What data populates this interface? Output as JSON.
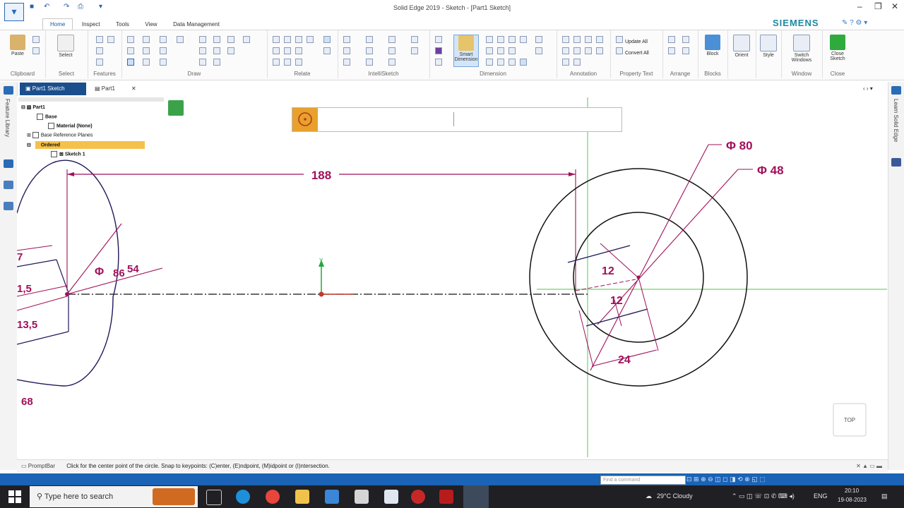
{
  "window": {
    "title": "Solid Edge 2019 - Sketch - [Part1 Sketch]",
    "brand": "SIEMENS",
    "controls": [
      "–",
      "❐",
      "✕"
    ]
  },
  "ribbon": {
    "tabs": [
      "Home",
      "Inspect",
      "Tools",
      "View",
      "Data Management"
    ],
    "active_tab": "Home",
    "groups": {
      "clipboard": {
        "label": "Clipboard",
        "paste": "Paste"
      },
      "select": {
        "label": "Select",
        "select": "Select"
      },
      "features": {
        "label": "Features"
      },
      "draw": {
        "label": "Draw"
      },
      "relate": {
        "label": "Relate"
      },
      "intellisketch": {
        "label": "IntelliSketch"
      },
      "dimension": {
        "label": "Dimension",
        "smart": "Smart Dimension"
      },
      "annotation": {
        "label": "Annotation"
      },
      "property_text": {
        "label": "Property Text",
        "update_all": "Update All",
        "convert_all": "Convert All"
      },
      "arrange": {
        "label": "Arrange"
      },
      "blocks": {
        "label": "Blocks",
        "block": "Block"
      },
      "window": {
        "label": "Window",
        "switch": "Switch Windows"
      },
      "close": {
        "label": "Close",
        "close_sketch": "Close Sketch"
      },
      "orient": {
        "label": "Orient"
      },
      "style": {
        "label": "Style"
      }
    }
  },
  "doc_tabs": {
    "tab1": "Part1 Sketch",
    "tab2": "Part1",
    "close": "✕",
    "nav": "‹ › ▾"
  },
  "left_dock": {
    "library": "Feature Library"
  },
  "right_dock": {
    "learn": "Learn Solid Edge"
  },
  "pathfinder": {
    "root": "Part1",
    "base": "Base",
    "material": "Material (None)",
    "planes": "Base Reference Planes",
    "ordered": "Ordered",
    "sketch": "Sketch 1"
  },
  "command_bar": {
    "icon": "circle-by-center-icon"
  },
  "drawing": {
    "dimensions": {
      "d188": "188",
      "phi80": "Φ 80",
      "phi48": "Φ 48",
      "d12a": "12",
      "d12b": "12",
      "d24": "24",
      "left_phi": "Φ ",
      "left_86": "86",
      "left_54": "54",
      "left_7": "7",
      "left_15": "1,5",
      "left_135": "13,5",
      "left_68": "68"
    },
    "view_cube": "TOP",
    "axis_y": "Y"
  },
  "prompt": {
    "label": "PromptBar",
    "text": "Click for the center point of the circle.  Snap to keypoints: (C)enter, (E)ndpoint, (M)idpoint or (I)ntersection."
  },
  "status": {
    "find_placeholder": "Find a command"
  },
  "taskbar": {
    "search": "Type here to search",
    "weather": "29°C  Cloudy",
    "lang": "ENG",
    "time": "20:10",
    "date": "19-08-2023"
  },
  "colors": {
    "accent": "#1b63b6",
    "dimension": "#a0105a",
    "brand": "#1b8aa0"
  }
}
